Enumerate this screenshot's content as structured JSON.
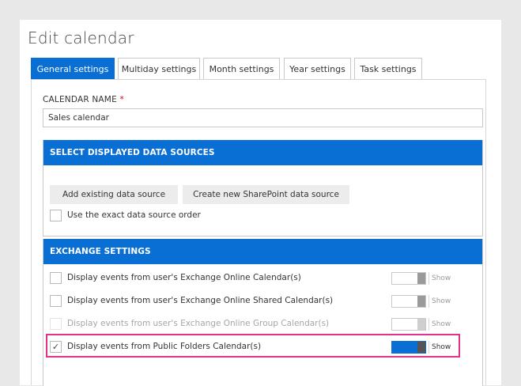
{
  "page": {
    "title": "Edit calendar"
  },
  "tabs": [
    {
      "label": "General settings",
      "active": true
    },
    {
      "label": "Multiday settings",
      "active": false
    },
    {
      "label": "Month settings",
      "active": false
    },
    {
      "label": "Year settings",
      "active": false
    },
    {
      "label": "Task settings",
      "active": false
    }
  ],
  "calendar_name": {
    "label": "CALENDAR NAME",
    "required_marker": "*",
    "value": "Sales calendar"
  },
  "data_sources": {
    "header": "SELECT DISPLAYED DATA SOURCES",
    "add_existing_label": "Add existing data source",
    "create_new_label": "Create new SharePoint data source",
    "exact_order": {
      "label": "Use the exact data source order",
      "checked": false
    }
  },
  "exchange": {
    "header": "EXCHANGE SETTINGS",
    "rows": [
      {
        "label": "Display events from user's Exchange Online Calendar(s)",
        "checked": false,
        "enabled": true,
        "toggle_on": false,
        "toggle_label": "Show"
      },
      {
        "label": "Display events from user's Exchange Online Shared Calendar(s)",
        "checked": false,
        "enabled": true,
        "toggle_on": false,
        "toggle_label": "Show"
      },
      {
        "label": "Display events from user's Exchange Online Group Calendar(s)",
        "checked": false,
        "enabled": false,
        "toggle_on": false,
        "toggle_label": "Show"
      },
      {
        "label": "Display events from Public Folders Calendar(s)",
        "checked": true,
        "enabled": true,
        "toggle_on": true,
        "toggle_label": "Show"
      }
    ]
  },
  "check_glyph": "✓",
  "colors": {
    "accent": "#0a6fd4",
    "highlight": "#e6318a",
    "required": "#d8000c"
  }
}
